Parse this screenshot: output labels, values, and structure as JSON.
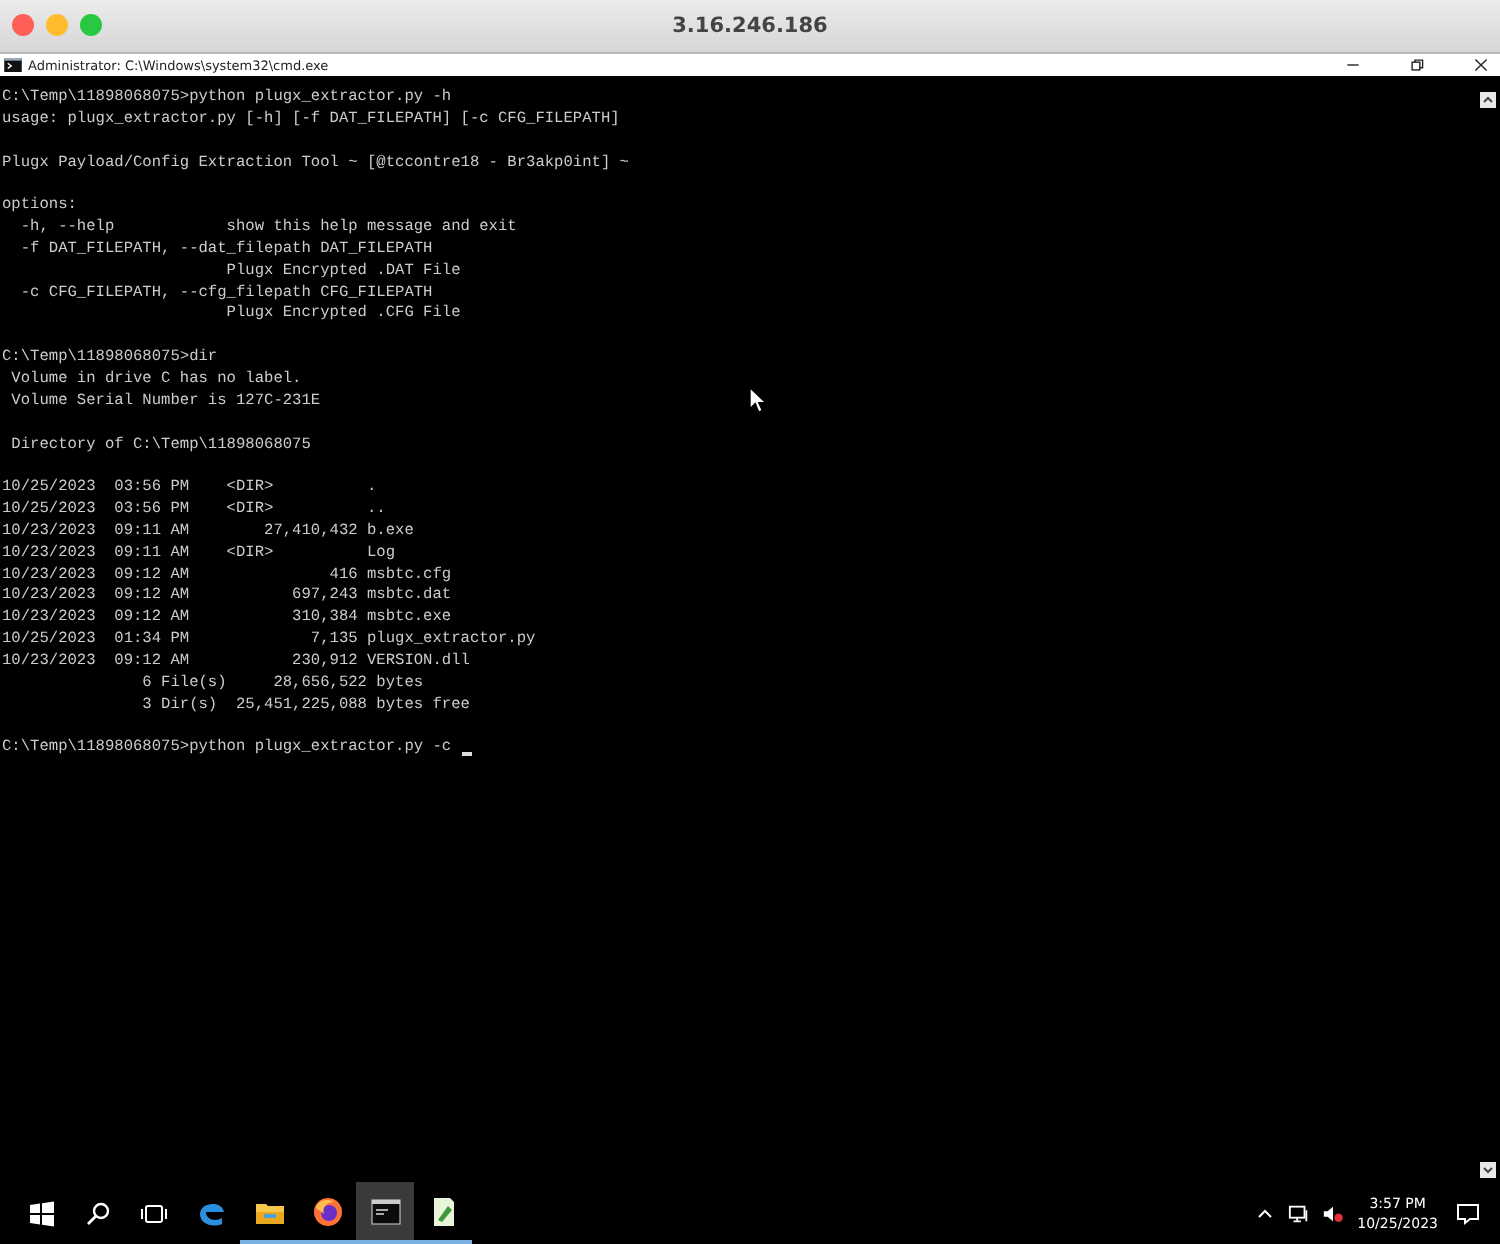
{
  "mac_window": {
    "title": "3.16.246.186"
  },
  "cmd_window": {
    "title": "Administrator: C:\\Windows\\system32\\cmd.exe",
    "blocks": [
      [
        "C:\\Temp\\11898068075>python plugx_extractor.py -h",
        "usage: plugx_extractor.py [-h] [-f DAT_FILEPATH] [-c CFG_FILEPATH]"
      ],
      [
        "Plugx Payload/Config Extraction Tool ~ [@tccontre18 - Br3akp0int] ~"
      ],
      [
        "options:",
        "  -h, --help            show this help message and exit",
        "  -f DAT_FILEPATH, --dat_filepath DAT_FILEPATH",
        "                        Plugx Encrypted .DAT File",
        "  -c CFG_FILEPATH, --cfg_filepath CFG_FILEPATH",
        "                        Plugx Encrypted .CFG File"
      ],
      [
        "C:\\Temp\\11898068075>dir",
        " Volume in drive C has no label.",
        " Volume Serial Number is 127C-231E"
      ],
      [
        " Directory of C:\\Temp\\11898068075"
      ],
      [
        "10/25/2023  03:56 PM    <DIR>          .",
        "10/25/2023  03:56 PM    <DIR>          ..",
        "10/23/2023  09:11 AM        27,410,432 b.exe",
        "10/23/2023  09:11 AM    <DIR>          Log",
        "10/23/2023  09:12 AM               416 msbtc.cfg",
        "10/23/2023  09:12 AM           697,243 msbtc.dat",
        "10/23/2023  09:12 AM           310,384 msbtc.exe",
        "10/25/2023  01:34 PM             7,135 plugx_extractor.py",
        "10/23/2023  09:12 AM           230,912 VERSION.dll",
        "               6 File(s)     28,656,522 bytes",
        "               3 Dir(s)  25,451,225,088 bytes free"
      ],
      [
        "C:\\Temp\\11898068075>python plugx_extractor.py -c"
      ]
    ]
  },
  "taskbar": {
    "apps": [
      {
        "kind": "edge",
        "running": false,
        "selected": false
      },
      {
        "kind": "explorer",
        "running": true,
        "selected": false
      },
      {
        "kind": "firefox",
        "running": true,
        "selected": false
      },
      {
        "kind": "terminal",
        "running": true,
        "selected": true
      },
      {
        "kind": "notepad",
        "running": true,
        "selected": false
      }
    ],
    "clock": {
      "time": "3:57 PM",
      "date": "10/25/2023"
    }
  }
}
